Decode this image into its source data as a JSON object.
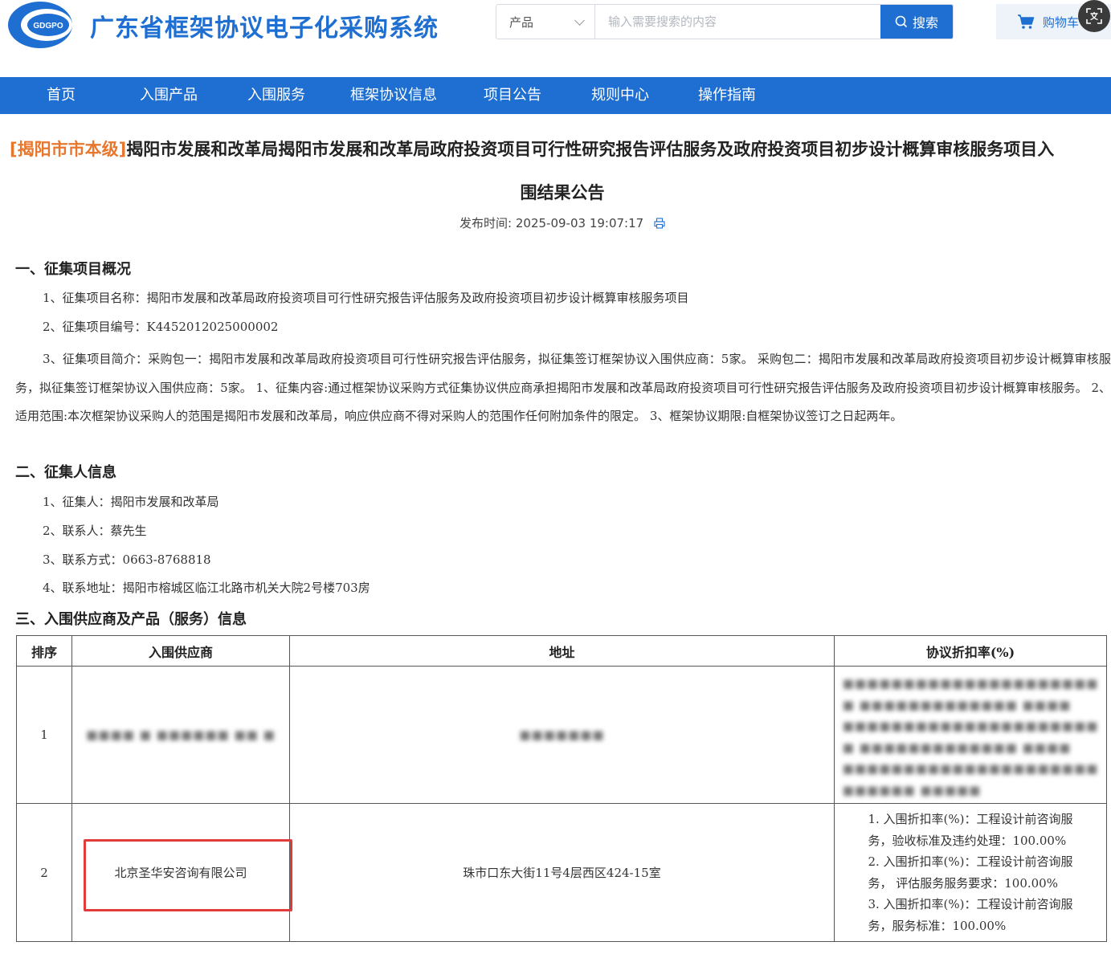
{
  "header": {
    "logo_text": "GDGPO",
    "site_title": "广东省框架协议电子化采购系统",
    "search": {
      "type_value": "产品",
      "placeholder": "输入需要搜索的内容",
      "button_label": "搜索"
    },
    "cart_label": "购物车",
    "translate_icon": "translate-icon"
  },
  "nav": {
    "items": [
      {
        "label": "首页"
      },
      {
        "label": "入围产品"
      },
      {
        "label": "入围服务"
      },
      {
        "label": "框架协议信息"
      },
      {
        "label": "项目公告"
      },
      {
        "label": "规则中心"
      },
      {
        "label": "操作指南"
      }
    ]
  },
  "article": {
    "tag": "[揭阳市市本级]",
    "title_line1": "揭阳市发展和改革局揭阳市发展和改革局政府投资项目可行性研究报告评估服务及政府投资项目初步设计概算审核服务项目入",
    "title_line2": "围结果公告",
    "publish_label": "发布时间:",
    "publish_time": "2025-09-03 19:07:17",
    "section1": {
      "heading": "一、征集项目概况",
      "item1": "1、征集项目名称：揭阳市发展和改革局政府投资项目可行性研究报告评估服务及政府投资项目初步设计概算审核服务项目",
      "item2": "2、征集项目编号：K4452012025000002",
      "item3": "3、征集项目简介：采购包一：揭阳市发展和改革局政府投资项目可行性研究报告评估服务，拟征集签订框架协议入围供应商：5家。 采购包二：揭阳市发展和改革局政府投资项目初步设计概算审核服务，拟征集签订框架协议入围供应商：5家。 1、征集内容:通过框架协议采购方式征集协议供应商承担揭阳市发展和改革局政府投资项目可行性研究报告评估服务及政府投资项目初步设计概算审核服务。 2、适用范围:本次框架协议采购人的范围是揭阳市发展和改革局，响应供应商不得对采购人的范围作任何附加条件的限定。 3、框架协议期限:自框架协议签订之日起两年。"
    },
    "section2": {
      "heading": "二、征集人信息",
      "items": [
        "1、征集人：揭阳市发展和改革局",
        "2、联系人：蔡先生",
        "3、联系方式：0663-8768818",
        "4、联系地址：揭阳市榕城区临江北路市机关大院2号楼703房"
      ]
    },
    "section3": {
      "heading": "三、入围供应商及产品（服务）信息"
    }
  },
  "table": {
    "headers": [
      "排序",
      "入围供应商",
      "地址",
      "协议折扣率(%)"
    ],
    "rows": [
      {
        "rank": "1",
        "supplier": "■■■■ ■ ■■■■■■ ■■ ■",
        "address": "■■■■■■■",
        "rates": [
          "■■■■■■■■■■■■■■■■■■■■■",
          "■ ■■■■■■■■■■■■■ ■■■■",
          "■■■■■■■■■■■■■■■■■■■■■",
          "■ ■■■■■■■■■■■■■ ■■■■",
          "■■■■■■■■■■■■■■■■■■■■■",
          "■■■■■■ ■■■■■"
        ]
      },
      {
        "rank": "2",
        "supplier": "北京圣华安咨询有限公司",
        "address": "珠市口东大街11号4层西区424-15室",
        "rates": [
          "1. 入围折扣率(%)：工程设计前咨询服",
          "务，验收标准及违约处理：100.00%",
          "2. 入围折扣率(%)：工程设计前咨询服",
          "务， 评估服务服务要求：100.00%",
          "3. 入围折扣率(%)：工程设计前咨询服",
          "务，服务标准：100.00%"
        ]
      }
    ]
  },
  "colors": {
    "brand_blue": "#1e6fd1",
    "tag_orange": "#e8772e",
    "highlight_red": "#e03c3c"
  }
}
